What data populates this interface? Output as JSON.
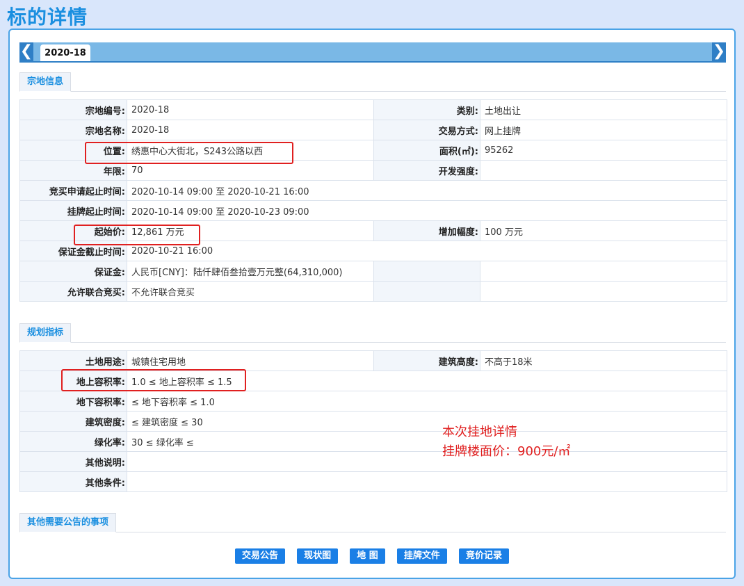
{
  "page_title": "标的详情",
  "tabbar": {
    "nav_left": "❮",
    "nav_right": "❯",
    "active_tab": "2020-18"
  },
  "sections": {
    "land_info": "宗地信息",
    "planning": "规划指标",
    "other": "其他需要公告的事项"
  },
  "land_info": {
    "parcel_no_label": "宗地编号:",
    "parcel_no": "2020-18",
    "category_label": "类别:",
    "category": "土地出让",
    "parcel_name_label": "宗地名称:",
    "parcel_name": "2020-18",
    "trade_mode_label": "交易方式:",
    "trade_mode": "网上挂牌",
    "location_label": "位置:",
    "location": "绣惠中心大街北，S243公路以西",
    "area_label": "面积(㎡):",
    "area": "95262",
    "term_label": "年限:",
    "term": "70",
    "dev_intensity_label": "开发强度:",
    "dev_intensity": "",
    "bid_apply_time_label": "竞买申请起止时间:",
    "bid_apply_time": "2020-10-14 09:00 至 2020-10-21 16:00",
    "listing_time_label": "挂牌起止时间:",
    "listing_time": "2020-10-14 09:00 至 2020-10-23 09:00",
    "start_price_label": "起始价:",
    "start_price": "12,861 万元",
    "increment_label": "增加幅度:",
    "increment": "100 万元",
    "deposit_deadline_label": "保证金截止时间:",
    "deposit_deadline": "2020-10-21 16:00",
    "deposit_label": "保证金:",
    "deposit": "人民币[CNY]：陆仟肆佰叁拾壹万元整(64,310,000)",
    "joint_bid_label": "允许联合竞买:",
    "joint_bid": "不允许联合竞买"
  },
  "planning": {
    "land_use_label": "土地用途:",
    "land_use": "城镇住宅用地",
    "height_label": "建筑高度:",
    "height": "不高于18米",
    "far_above_label": "地上容积率:",
    "far_above": "1.0 ≤ 地上容积率 ≤ 1.5",
    "far_below_label": "地下容积率:",
    "far_below": "≤ 地下容积率 ≤ 1.0",
    "density_label": "建筑密度:",
    "density": "≤ 建筑密度 ≤ 30",
    "green_label": "绿化率:",
    "green": "30 ≤ 绿化率 ≤",
    "other_desc_label": "其他说明:",
    "other_desc": "",
    "other_cond_label": "其他条件:",
    "other_cond": ""
  },
  "annotation": {
    "line1": "本次挂地详情",
    "line2": "挂牌楼面价：900元/㎡"
  },
  "buttons": {
    "announcement": "交易公告",
    "status_map": "现状图",
    "map": "地 图",
    "listing_docs": "挂牌文件",
    "bid_records": "竞价记录"
  }
}
